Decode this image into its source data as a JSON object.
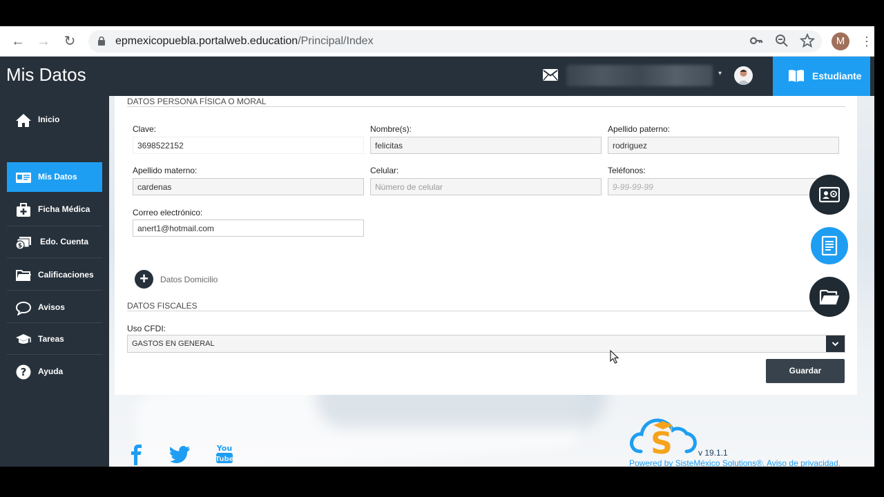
{
  "browser": {
    "url_host": "epmexicopuebla.portalweb.education",
    "url_path": "/Principal/Index",
    "profile_initial": "M"
  },
  "header": {
    "title": "Mis Datos",
    "role_button": "Estudiante",
    "accent": "#1e9ef2",
    "dark": "#27313b"
  },
  "sidebar": {
    "items": [
      {
        "label": "Inicio",
        "icon": "home-icon"
      },
      {
        "label": "Mis Datos",
        "icon": "id-card-icon",
        "active": true
      },
      {
        "label": "Ficha Médica",
        "icon": "medical-kit-icon"
      },
      {
        "label": "Edo. Cuenta",
        "icon": "money-icon"
      },
      {
        "label": "Calificaciones",
        "icon": "folder-icon"
      },
      {
        "label": "Avisos",
        "icon": "chat-bubble-icon"
      },
      {
        "label": "Tareas",
        "icon": "graduation-cap-icon"
      },
      {
        "label": "Ayuda",
        "icon": "help-icon"
      }
    ]
  },
  "form": {
    "section_personal": "DATOS PERSONA FÍSICA O MORAL",
    "clave_label": "Clave:",
    "clave_value": "3698522152",
    "nombre_label": "Nombre(s):",
    "nombre_value": "felicitas",
    "ap_paterno_label": "Apellido paterno:",
    "ap_paterno_value": "rodriguez",
    "ap_materno_label": "Apellido materno:",
    "ap_materno_value": "cardenas",
    "celular_label": "Celular:",
    "celular_placeholder": "Número de celular",
    "telefonos_label": "Teléfonos:",
    "telefonos_placeholder": "9-99-99-99",
    "correo_label": "Correo electrónico:",
    "correo_value": "anert1@hotmail.com",
    "domicilio_label": "Datos Domicilio",
    "section_fiscal": "DATOS FISCALES",
    "cfdi_label": "Uso CFDI:",
    "cfdi_value": "GASTOS EN GENERAL",
    "save_label": "Guardar"
  },
  "fabs": [
    {
      "icon": "contact-card-icon",
      "color": "#1f2a33"
    },
    {
      "icon": "document-icon",
      "color": "#1e9ef2"
    },
    {
      "icon": "open-folder-icon",
      "color": "#1f2a33"
    }
  ],
  "footer": {
    "version": "v 19.1.1",
    "powered": "Powered by SisteMéxico Solutions®. Aviso de privacidad.",
    "social": [
      "facebook-icon",
      "twitter-icon",
      "youtube-icon"
    ]
  }
}
